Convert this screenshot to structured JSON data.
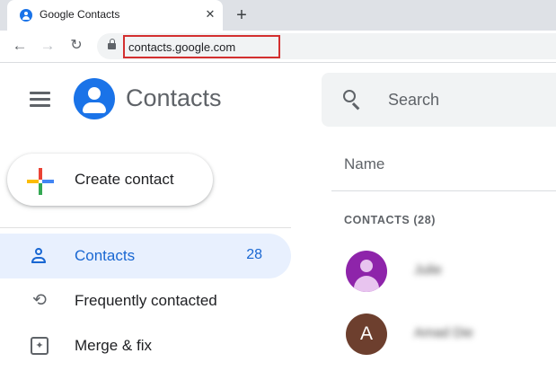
{
  "browser": {
    "tab_title": "Google Contacts",
    "tab_close": "✕",
    "new_tab": "+",
    "back": "←",
    "forward": "→",
    "reload": "↻",
    "url": "contacts.google.com"
  },
  "app": {
    "title": "Contacts",
    "brand_color": "#1a73e8"
  },
  "search": {
    "placeholder": "Search",
    "value": ""
  },
  "sidebar": {
    "create_label": "Create contact",
    "items": [
      {
        "label": "Contacts",
        "count": "28",
        "icon": "person-icon",
        "active": true
      },
      {
        "label": "Frequently contacted",
        "icon": "history-icon",
        "active": false
      },
      {
        "label": "Merge & fix",
        "icon": "merge-fix-icon",
        "active": false
      }
    ]
  },
  "list": {
    "column_header": "Name",
    "section_label": "CONTACTS (28)",
    "contacts": [
      {
        "avatar_letter": "",
        "avatar_color": "#8e24aa",
        "name": "Julie"
      },
      {
        "avatar_letter": "A",
        "avatar_color": "#6d3f2e",
        "name": "Amad Die"
      }
    ]
  },
  "colors": {
    "active_bg": "#e8f0fe",
    "active_text": "#1967d2",
    "highlight_box": "#d32f2f"
  }
}
